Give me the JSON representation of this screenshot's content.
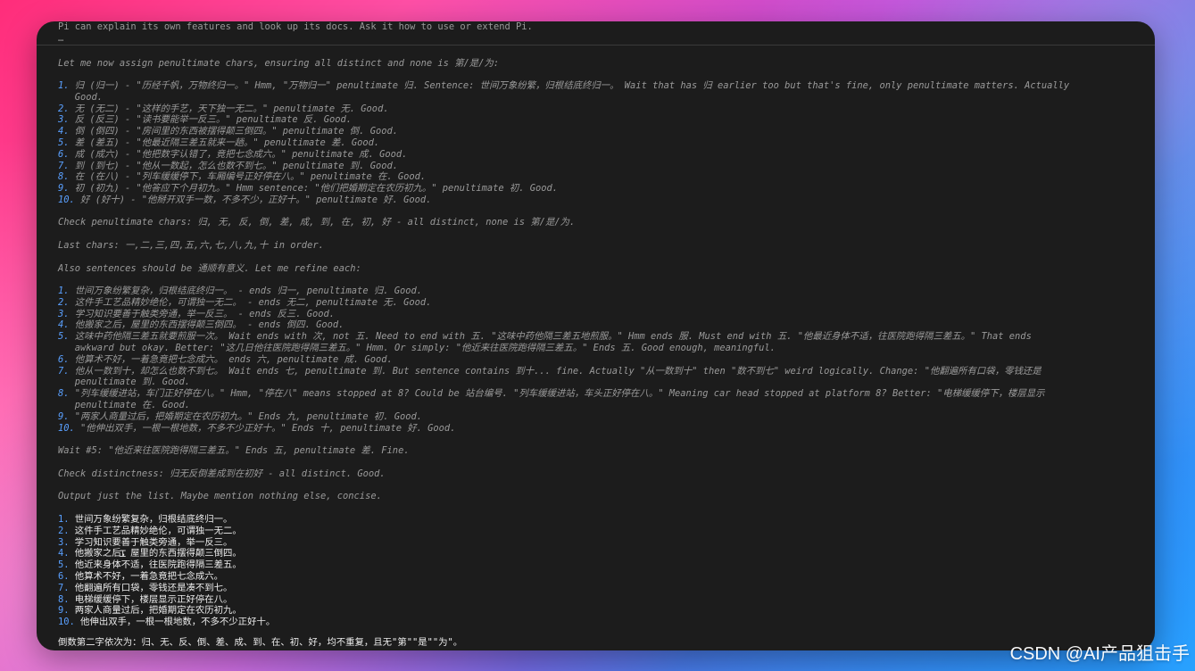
{
  "ui": {
    "watermark": "CSDN @AI产品狙击手"
  },
  "terminal": {
    "intro": "Pi can explain its own features and look up its docs. Ask it how to use or extend Pi.",
    "cursor": "…",
    "assign_heading": "Let me now assign penultimate chars, ensuring all distinct and none is 第/是/为:",
    "assign_items": [
      {
        "num": "1.",
        "text": "归 (归一) - \"历经千帆，万物终归一。\" Hmm, \"万物归一\" penultimate 归. Sentence: 世间万象纷繁，归根结底终归一。 Wait that has 归 earlier too but that's fine, only penultimate matters. Actually"
      },
      {
        "num": "",
        "text": "Good."
      },
      {
        "num": "2.",
        "text": "无 (无二) - \"这样的手艺，天下独一无二。\" penultimate 无. Good."
      },
      {
        "num": "3.",
        "text": "反 (反三) - \"读书要能举一反三。\" penultimate 反. Good."
      },
      {
        "num": "4.",
        "text": "倒 (倒四) - \"房间里的东西被摆得颠三倒四。\" penultimate 倒. Good."
      },
      {
        "num": "5.",
        "text": "差 (差五) - \"他最近隔三差五就来一趟。\" penultimate 差. Good."
      },
      {
        "num": "6.",
        "text": "成 (成六) - \"他把数字认错了，竟把七念成六。\" penultimate 成. Good."
      },
      {
        "num": "7.",
        "text": "到 (到七) - \"他从一数起，怎么也数不到七。\" penultimate 到. Good."
      },
      {
        "num": "8.",
        "text": "在 (在八) - \"列车缓缓停下，车厢编号正好停在八。\" penultimate 在. Good."
      },
      {
        "num": "9.",
        "text": "初 (初九) - \"他答应下个月初九。\" Hmm sentence: \"他们把婚期定在农历初九。\" penultimate 初. Good."
      },
      {
        "num": "10.",
        "text": "好 (好十) - \"他掰开双手一数，不多不少，正好十。\" penultimate 好. Good."
      }
    ],
    "check_penultimate": "Check penultimate chars: 归, 无, 反, 倒, 差, 成, 到, 在, 初, 好 - all distinct, none is 第/是/为.",
    "last_chars": "Last chars: 一,二,三,四,五,六,七,八,九,十 in order.",
    "refine_heading": "Also sentences should be 通顺有意义. Let me refine each:",
    "refine_items": [
      {
        "num": "1.",
        "text": "世间万象纷繁复杂，归根结底终归一。 - ends 归一, penultimate 归. Good."
      },
      {
        "num": "2.",
        "text": "这件手工艺品精妙绝伦，可谓独一无二。 - ends 无二, penultimate 无. Good."
      },
      {
        "num": "3.",
        "text": "学习知识要善于触类旁通，举一反三。 - ends 反三. Good."
      },
      {
        "num": "4.",
        "text": "他搬家之后，屋里的东西摆得颠三倒四。 - ends 倒四. Good."
      },
      {
        "num": "5.",
        "text": "这味中药他隔三差五就要煎服一次。 Wait ends with 次, not 五. Need to end with 五. \"这味中药他隔三差五地煎服。\" Hmm ends 服. Must end with 五. \"他最近身体不适，往医院跑得隔三差五。\" That ends"
      },
      {
        "num": "",
        "text": "awkward but okay. Better: \"这几日他往医院跑得隔三差五。\" Hmm. Or simply: \"他近来往医院跑得隔三差五。\" Ends 五. Good enough, meaningful."
      },
      {
        "num": "6.",
        "text": "他算术不好，一着急竟把七念成六。 ends 六, penultimate 成. Good."
      },
      {
        "num": "7.",
        "text": "他从一数到十，却怎么也数不到七。 Wait ends 七, penultimate 到. But sentence contains 到十... fine. Actually \"从一数到十\" then \"数不到七\" weird logically. Change: \"他翻遍所有口袋，零钱还是"
      },
      {
        "num": "",
        "text": "penultimate 到. Good."
      },
      {
        "num": "8.",
        "text": "\"列车缓缓进站，车门正好停在八。\" Hmm, \"停在八\" means stopped at 8? Could be 站台编号. \"列车缓缓进站，车头正好停在八。\" Meaning car head stopped at platform 8? Better: \"电梯缓缓停下，楼层显示"
      },
      {
        "num": "",
        "text": "penultimate 在. Good."
      },
      {
        "num": "9.",
        "text": "\"两家人商量过后，把婚期定在农历初九。\" Ends 九, penultimate 初. Good."
      },
      {
        "num": "10.",
        "text": "\"他伸出双手，一根一根地数，不多不少正好十。\" Ends 十, penultimate 好. Good."
      }
    ],
    "wait_5": "Wait #5: \"他近来往医院跑得隔三差五。\" Ends 五, penultimate 差. Fine.",
    "check_distinct": "Check distinctness: 归无反倒差成到在初好 - all distinct. Good.",
    "output_note": "Output just the list. Maybe mention nothing else, concise.",
    "final_items": [
      {
        "num": "1.",
        "text": "世间万象纷繁复杂，归根结底终归一。"
      },
      {
        "num": "2.",
        "text": "这件手工艺品精妙绝伦，可谓独一无二。"
      },
      {
        "num": "3.",
        "text": "学习知识要善于触类旁通，举一反三。"
      },
      {
        "num": "4.",
        "text": "他搬家之后，屋里的东西摆得颠三倒四。"
      },
      {
        "num": "5.",
        "text": "他近来身体不适，往医院跑得隔三差五。"
      },
      {
        "num": "6.",
        "text": "他算术不好，一着急竟把七念成六。"
      },
      {
        "num": "7.",
        "text": "他翻遍所有口袋，零钱还是凑不到七。"
      },
      {
        "num": "8.",
        "text": "电梯缓缓停下，楼层显示正好停在八。"
      },
      {
        "num": "9.",
        "text": "两家人商量过后，把婚期定在农历初九。"
      },
      {
        "num": "10.",
        "text": "他伸出双手，一根一根地数，不多不少正好十。"
      }
    ],
    "summary": "倒数第二字依次为：归、无、反、倒、差、成、到、在、初、好，均不重复，且无\"第\"\"是\"\"为\"。"
  }
}
